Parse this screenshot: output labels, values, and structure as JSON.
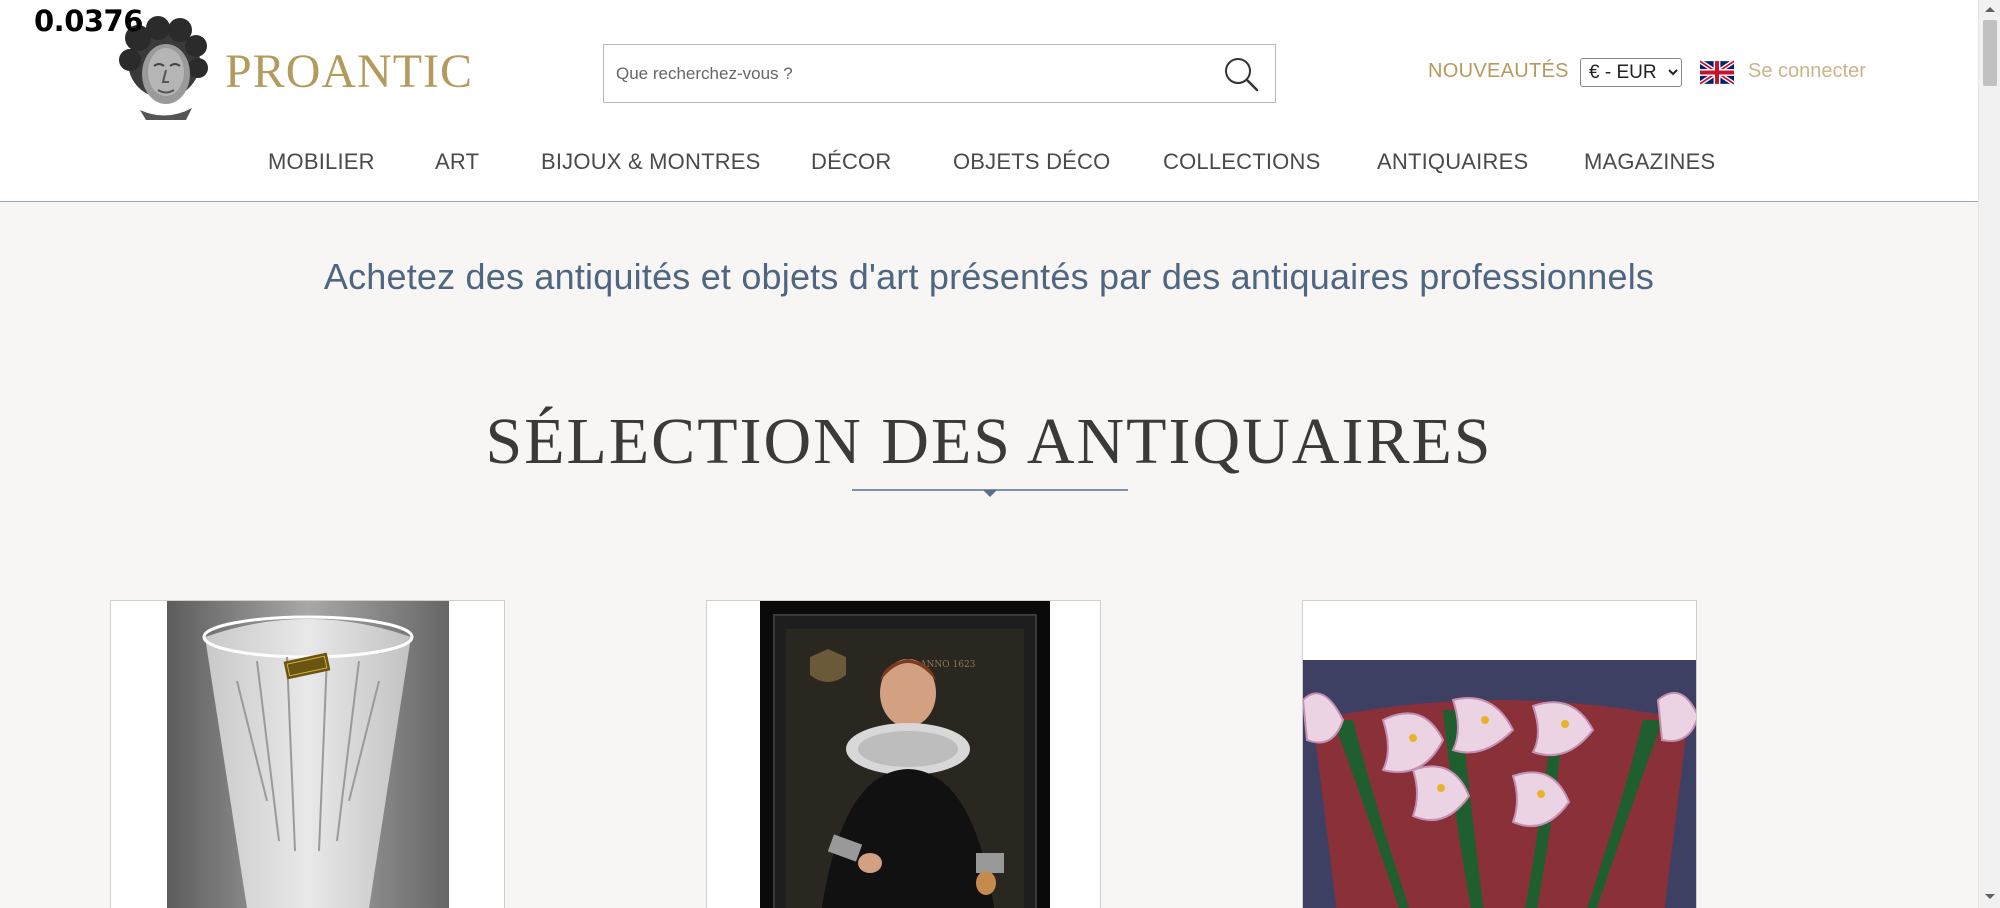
{
  "overlay": {
    "value": "0.0376"
  },
  "header": {
    "brand": "PROANTIC",
    "search": {
      "placeholder": "Que recherchez-vous ?",
      "value": ""
    },
    "nouveautes": "NOUVEAUTÉS",
    "currency": {
      "selected": "€ - EUR",
      "options": [
        "€ - EUR"
      ]
    },
    "language_flag": "uk-flag-icon",
    "login": "Se connecter"
  },
  "nav": {
    "items": [
      {
        "label": "MOBILIER"
      },
      {
        "label": "ART"
      },
      {
        "label": "BIJOUX & MONTRES"
      },
      {
        "label": "DÉCOR"
      },
      {
        "label": "OBJETS DÉCO"
      },
      {
        "label": "COLLECTIONS"
      },
      {
        "label": "ANTIQUAIRES"
      },
      {
        "label": "MAGAZINES"
      }
    ]
  },
  "main": {
    "tagline": "Achetez des antiquités et objets d'art présentés par des antiquaires professionnels",
    "section_title": "SÉLECTION DES ANTIQUAIRES",
    "cards": [
      {
        "subject": "crystal-vase-image"
      },
      {
        "subject": "portrait-painting-image"
      },
      {
        "subject": "calla-lily-cachepot-image"
      }
    ]
  },
  "colors": {
    "brand_gold": "#b59a5e",
    "tagline_blue": "#4f6682",
    "divider_blue": "#5a6f8a",
    "background": "#f7f6f4"
  }
}
